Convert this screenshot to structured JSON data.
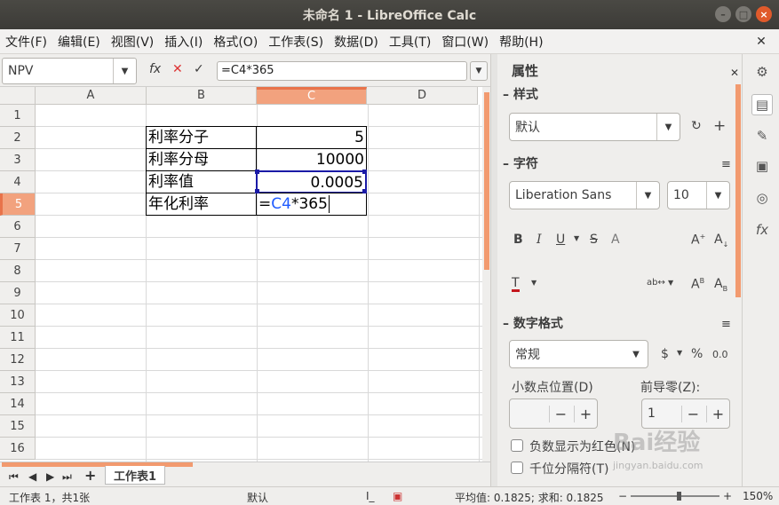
{
  "window": {
    "title": "未命名 1 - LibreOffice Calc"
  },
  "menu": [
    "文件(F)",
    "编辑(E)",
    "视图(V)",
    "插入(I)",
    "格式(O)",
    "工作表(S)",
    "数据(D)",
    "工具(T)",
    "窗口(W)",
    "帮助(H)"
  ],
  "formula_bar": {
    "name_box": "NPV",
    "fx": "fx",
    "cancel": "✕",
    "accept": "✓",
    "formula": "=C4*365"
  },
  "columns": [
    "A",
    "B",
    "C",
    "D"
  ],
  "rows": [
    "1",
    "2",
    "3",
    "4",
    "5",
    "6",
    "7",
    "8",
    "9",
    "10",
    "11",
    "12",
    "13",
    "14",
    "15",
    "16"
  ],
  "cells": {
    "B2": "利率分子",
    "C2": "5",
    "B3": "利率分母",
    "C3": "10000",
    "B4": "利率值",
    "C4": "0.0005",
    "B5": "年化利率",
    "C5_eq": "=",
    "C5_ref": "C4",
    "C5_rest": "*365"
  },
  "sheet_tabs": {
    "active": "工作表1",
    "add": "+"
  },
  "status": {
    "sheet_info": "工作表 1，共1张",
    "style": "默认",
    "stats": "平均值: 0.1825; 求和: 0.1825",
    "zoom": "150%",
    "minus": "−",
    "plus": "+"
  },
  "sidebar": {
    "title": "属性",
    "styles": {
      "header": "样式",
      "value": "默认"
    },
    "character": {
      "header": "字符",
      "font": "Liberation Sans",
      "size": "10"
    },
    "number_format": {
      "header": "数字格式",
      "category": "常规",
      "currency": "$",
      "percent": "%",
      "decimal": "0.0",
      "decimal_places_label": "小数点位置(D)",
      "leading_zeros_label": "前导零(Z):",
      "leading_zeros_value": "1",
      "negative_red_label": "负数显示为红色(N)",
      "thousands_label": "千位分隔符(T)"
    }
  },
  "colors": {
    "accent": "#e8734a",
    "selection_border": "#1a1aa6",
    "ref_blue": "#1f5bff"
  },
  "watermark": {
    "text": "Bai经验",
    "sub": "jingyan.baidu.com"
  }
}
